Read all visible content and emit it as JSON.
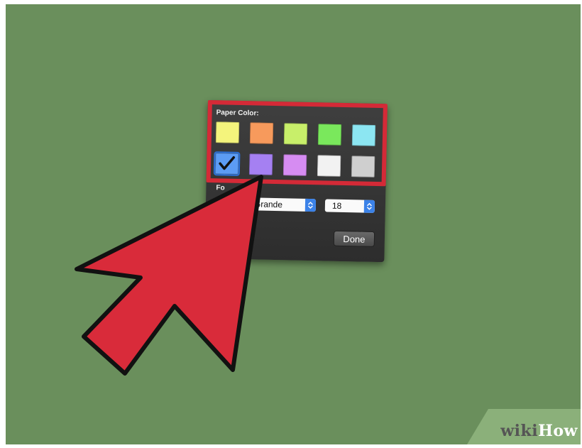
{
  "popover": {
    "paper_color_label": "Paper Color:",
    "font_label": "Fo",
    "font_value": "Grande",
    "size_value": "18",
    "done_label": "Done"
  },
  "swatches": [
    {
      "name": "yellow",
      "color": "#f4f47c",
      "selected": false
    },
    {
      "name": "orange",
      "color": "#f79a5c",
      "selected": false
    },
    {
      "name": "lime",
      "color": "#c8ef6a",
      "selected": false
    },
    {
      "name": "green",
      "color": "#7ae85c",
      "selected": false
    },
    {
      "name": "cyan",
      "color": "#8ce6f2",
      "selected": false
    },
    {
      "name": "blue",
      "color": "#5c9cf4",
      "selected": true
    },
    {
      "name": "purple",
      "color": "#a580f2",
      "selected": false
    },
    {
      "name": "pink",
      "color": "#d68cf2",
      "selected": false
    },
    {
      "name": "white",
      "color": "#f2f2f2",
      "selected": false
    },
    {
      "name": "gray",
      "color": "#cfcfcf",
      "selected": false
    }
  ],
  "colors": {
    "background": "#6a8f5c",
    "highlight": "#d42a37",
    "arrow": "#d92b3a"
  },
  "watermark": {
    "wiki": "wiki",
    "how": "How"
  }
}
